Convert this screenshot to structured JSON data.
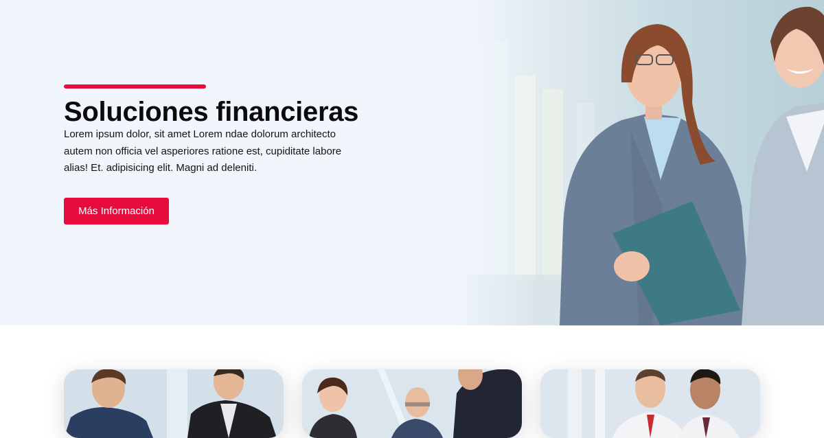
{
  "hero": {
    "title": "Soluciones financieras",
    "text": "Lorem ipsum dolor, sit amet Lorem ndae dolorum architecto autem non officia vel asperiores ratione est, cupiditate labore alias! Et. adipisicing elit. Magni ad deleniti.",
    "cta_label": "Más Información",
    "accent_color": "#e80c3d",
    "image": "businesswomen-with-clipboard-photo"
  },
  "cards": [
    {
      "image": "business-team-meeting-photo"
    },
    {
      "image": "colleagues-reviewing-documents-photo"
    },
    {
      "image": "businessmen-discussion-photo"
    }
  ]
}
